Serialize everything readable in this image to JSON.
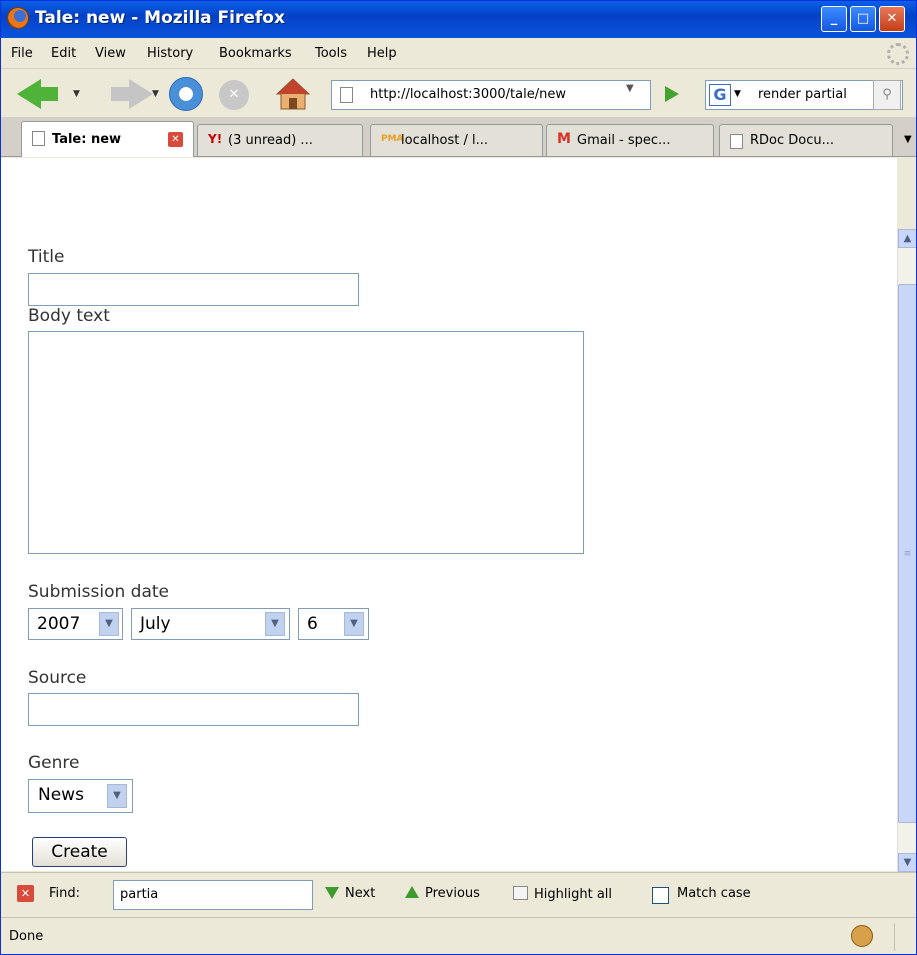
{
  "window": {
    "title": "Tale: new - Mozilla Firefox",
    "min_label": "_",
    "max_label": "□",
    "close_label": "✕"
  },
  "menu": [
    "File",
    "Edit",
    "View",
    "History",
    "Bookmarks",
    "Tools",
    "Help"
  ],
  "nav": {
    "url": "http://localhost:3000/tale/new",
    "search_engine_icon": "G",
    "search_value": "render partial"
  },
  "tabs": [
    {
      "label": "Tale: new",
      "icon": "page-icon",
      "active": true
    },
    {
      "label": "(3 unread) ...",
      "icon": "yahoo-icon"
    },
    {
      "label": "localhost / l...",
      "icon": "phpmyadmin-icon"
    },
    {
      "label": "Gmail - spec...",
      "icon": "gmail-icon"
    },
    {
      "label": "RDoc Docu...",
      "icon": "page-icon"
    }
  ],
  "form": {
    "title_label": "Title",
    "title_value": "",
    "body_label": "Body text",
    "body_value": "",
    "date_label": "Submission date",
    "date_year": "2007",
    "date_month": "July",
    "date_day": "6",
    "source_label": "Source",
    "source_value": "",
    "genre_label": "Genre",
    "genre_value": "News",
    "submit_label": "Create"
  },
  "findbar": {
    "find_label": "Find:",
    "find_value": "partia",
    "next_label": "Next",
    "previous_label": "Previous",
    "highlight_label": "Highlight all",
    "match_case_label": "Match case"
  },
  "status": {
    "text": "Done"
  }
}
